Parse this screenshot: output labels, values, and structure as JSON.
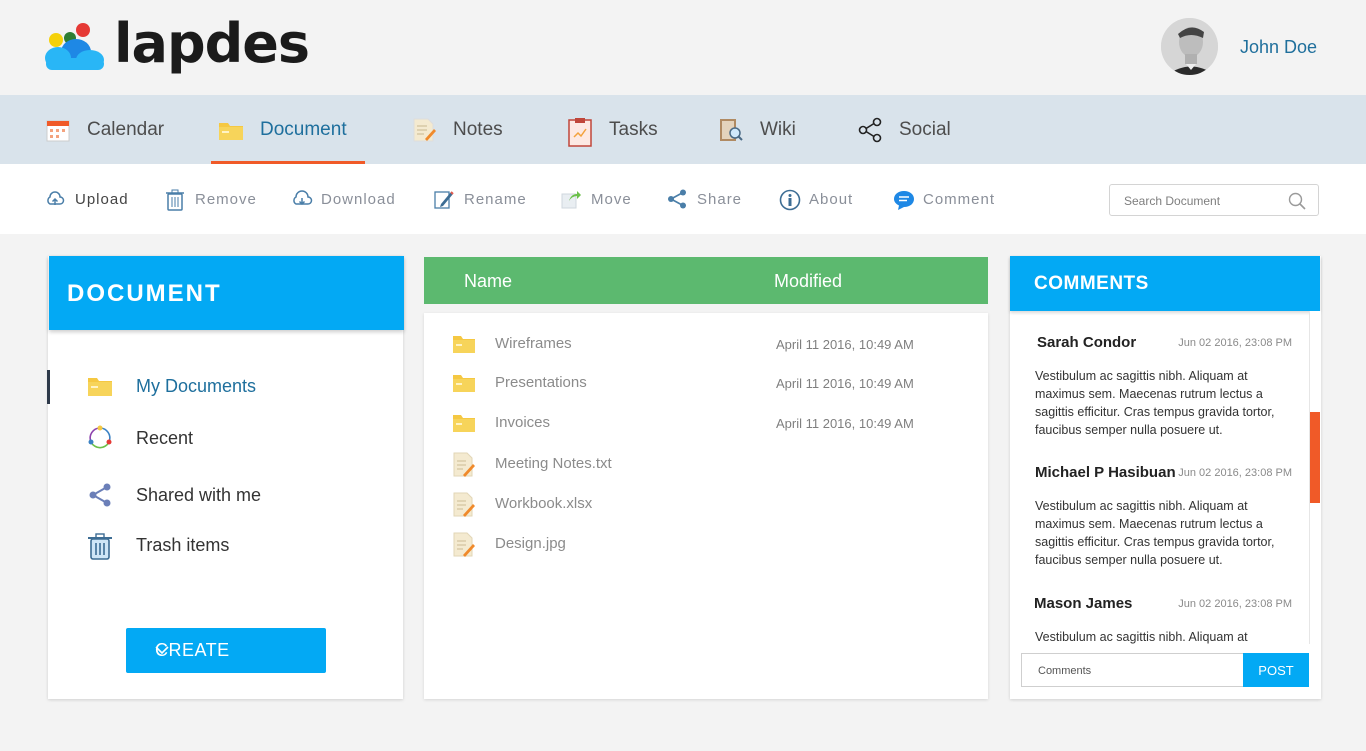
{
  "brand": {
    "name": "lapdes"
  },
  "user": {
    "name": "John Doe"
  },
  "nav": {
    "items": [
      {
        "label": "Calendar",
        "icon": "calendar-icon"
      },
      {
        "label": "Document",
        "icon": "folder-icon",
        "active": true
      },
      {
        "label": "Notes",
        "icon": "notes-icon"
      },
      {
        "label": "Tasks",
        "icon": "tasks-icon"
      },
      {
        "label": "Wiki",
        "icon": "wiki-icon"
      },
      {
        "label": "Social",
        "icon": "share-icon"
      }
    ]
  },
  "toolbar": {
    "items": [
      {
        "label": "Upload",
        "icon": "cloud-upload-icon"
      },
      {
        "label": "Remove",
        "icon": "trash-icon"
      },
      {
        "label": "Download",
        "icon": "cloud-download-icon"
      },
      {
        "label": "Rename",
        "icon": "pencil-icon"
      },
      {
        "label": "Move",
        "icon": "move-icon"
      },
      {
        "label": "Share",
        "icon": "share-icon"
      },
      {
        "label": "About",
        "icon": "info-icon"
      },
      {
        "label": "Comment",
        "icon": "comment-icon"
      }
    ],
    "search_placeholder": "Search Document"
  },
  "sidebar": {
    "title": "DOCUMENT",
    "items": [
      {
        "label": "My Documents",
        "icon": "folder-icon",
        "active": true
      },
      {
        "label": "Recent",
        "icon": "recent-icon"
      },
      {
        "label": "Shared with me",
        "icon": "share-icon"
      },
      {
        "label": "Trash items",
        "icon": "trash-icon"
      }
    ],
    "create_label": "CREATE"
  },
  "files": {
    "columns": [
      "Name",
      "Modified"
    ],
    "rows": [
      {
        "name": "Wireframes",
        "modified": "April 11 2016, 10:49 AM",
        "type": "folder"
      },
      {
        "name": "Presentations",
        "modified": "April 11 2016, 10:49 AM",
        "type": "folder"
      },
      {
        "name": "Invoices",
        "modified": "April 11 2016, 10:49 AM",
        "type": "folder"
      },
      {
        "name": "Meeting Notes.txt",
        "modified": "",
        "type": "file"
      },
      {
        "name": "Workbook.xlsx",
        "modified": "",
        "type": "file"
      },
      {
        "name": "Design.jpg",
        "modified": "",
        "type": "file"
      }
    ]
  },
  "comments": {
    "title": "COMMENTS",
    "items": [
      {
        "author": "Sarah Condor",
        "time": "Jun 02 2016, 23:08 PM",
        "text": "Vestibulum ac sagittis nibh. Aliquam at maximus sem. Maecenas rutrum lectus a sagittis efficitur. Cras tempus gravida tortor, faucibus semper nulla posuere ut."
      },
      {
        "author": "Michael P Hasibuan",
        "time": "Jun 02 2016, 23:08 PM",
        "text": "Vestibulum ac sagittis nibh. Aliquam at maximus sem. Maecenas rutrum lectus a sagittis efficitur. Cras tempus gravida tortor, faucibus semper nulla posuere ut."
      },
      {
        "author": "Mason James",
        "time": "Jun 02 2016, 23:08 PM",
        "text": "Vestibulum ac sagittis nibh. Aliquam at maximus sem. Maecenas rutrum lectus a sagittis efficitur. Cras tempus gravida tortor, faucibus semper nulla posuere ut."
      }
    ],
    "input_placeholder": "Comments",
    "post_label": "POST"
  },
  "colors": {
    "accent": "#03a9f4",
    "nav_active": "#1e6f9d",
    "highlight": "#f05a28",
    "table_header": "#5cb96f",
    "nav_bg": "#d9e3eb"
  }
}
